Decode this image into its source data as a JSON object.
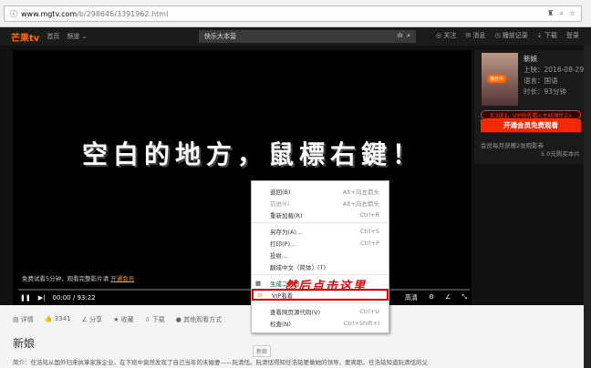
{
  "browser": {
    "url_host": "www.mgtv.com",
    "url_path": "/b/298646/3391962.html"
  },
  "nav": {
    "logo": "芒果tv",
    "home": "首页",
    "channels": "频道 ⌄",
    "search_value": "快乐大本营",
    "follow": "◎ 关注",
    "messages": "✉ 消息",
    "history": "◷ 播放记录",
    "download": "⇣ 下载",
    "login": "登录"
  },
  "video": {
    "overlay_text": "空白的地方，鼠標右鍵！",
    "trial_text": "免费试看5分钟，观看完整影片请",
    "trial_link": "开通会员",
    "time": "00:00 / 93:22",
    "quality": "高清"
  },
  "side": {
    "title": "新娘",
    "release": "上映：2016-08-29",
    "language": "语言：国语",
    "duration": "时长：93分钟",
    "badge": "播放中",
    "promo": "买3送1，VIP抢先看<主妇很忙2>",
    "vip_button": "开通会员免费观看",
    "note1": "会员每月获赠2张观影券",
    "note2": "5.0元购买本片"
  },
  "menu": {
    "items": [
      {
        "label": "返回(B)",
        "key": "Alt+向左箭头"
      },
      {
        "label": "前进(F)",
        "key": "Alt+向右箭头"
      },
      {
        "label": "重新加载(R)",
        "key": "Ctrl+R"
      },
      {
        "label": "另存为(A)...",
        "key": "Ctrl+S"
      },
      {
        "label": "打印(P)...",
        "key": "Ctrl+P"
      },
      {
        "label": "投射...",
        "key": ""
      },
      {
        "label": "翻成中文（简体）(T)",
        "key": ""
      },
      {
        "label": "生成二维码",
        "key": ""
      },
      {
        "label": "VIP看看",
        "key": ""
      },
      {
        "label": "查看网页源代码(V)",
        "key": "Ctrl+U"
      },
      {
        "label": "检查(N)",
        "key": "Ctrl+Shift+I"
      }
    ]
  },
  "annotation": "然后点击这里",
  "actions": {
    "detail": "详情",
    "likes": "3341",
    "share": "分享",
    "favorite": "收藏",
    "download": "下载",
    "other": "其他观看方式"
  },
  "page": {
    "title": "新娘",
    "tooltip": "新娘",
    "desc": "简介：任浩铭从国外归来执掌家族企业，在下班中竟然发现了自己当年的未婚妻——阮清恬。阮清恬得知任浩铭要做她的领导，要离职。任浩铭知道阮清恬的父"
  }
}
